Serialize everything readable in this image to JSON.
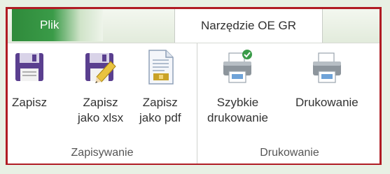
{
  "tabs": {
    "file_label": "Plik",
    "active_label": "Narzędzie OE GR"
  },
  "groups": {
    "save": {
      "label": "Zapisywanie",
      "buttons": {
        "save": {
          "label": "Zapisz",
          "icon": "floppy-disk-icon"
        },
        "save_xlsx": {
          "label": "Zapisz\njako xlsx",
          "icon": "floppy-disk-pencil-icon"
        },
        "save_pdf": {
          "label": "Zapisz\njako pdf",
          "icon": "document-icon"
        }
      }
    },
    "print": {
      "label": "Drukowanie",
      "buttons": {
        "quick_print": {
          "label": "Szybkie\ndrukowanie",
          "icon": "printer-check-icon"
        },
        "print": {
          "label": "Drukowanie",
          "icon": "printer-icon"
        }
      }
    }
  },
  "colors": {
    "file_tab": "#2f8a3b",
    "frame_border": "#b01c24",
    "floppy": "#5a3f8f"
  }
}
